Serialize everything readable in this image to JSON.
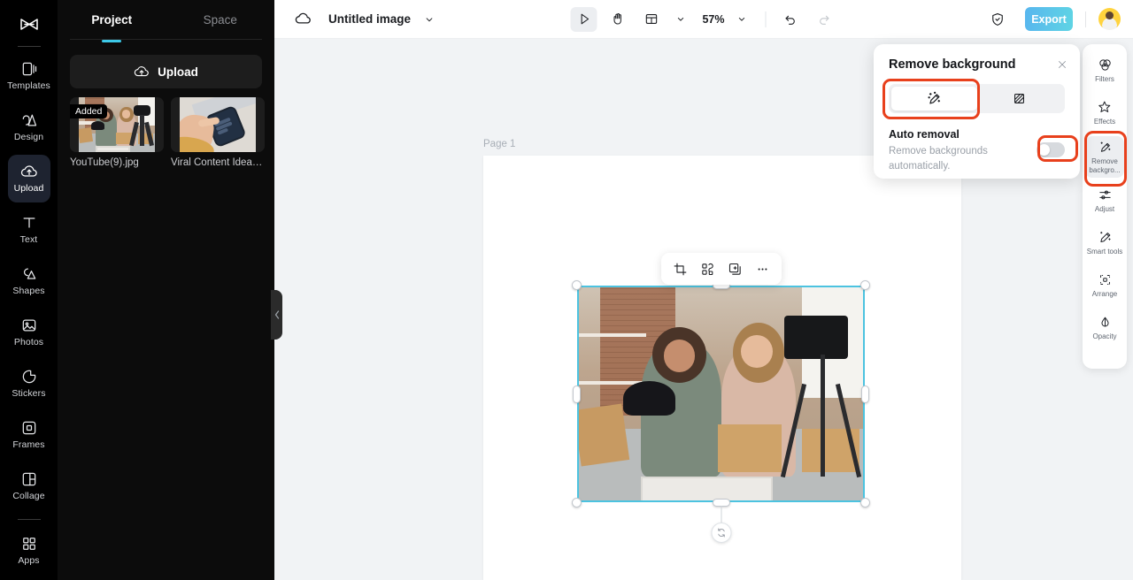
{
  "app": {
    "name": "CapCut",
    "logo_icon": "capcut-logo-icon"
  },
  "rail": {
    "items": [
      {
        "label": "Templates",
        "icon": "templates-icon",
        "active": false
      },
      {
        "label": "Design",
        "icon": "design-icon",
        "active": false
      },
      {
        "label": "Upload",
        "icon": "upload-cloud-icon",
        "active": true
      },
      {
        "label": "Text",
        "icon": "text-icon",
        "active": false
      },
      {
        "label": "Shapes",
        "icon": "shapes-icon",
        "active": false
      },
      {
        "label": "Photos",
        "icon": "photos-icon",
        "active": false
      },
      {
        "label": "Stickers",
        "icon": "stickers-icon",
        "active": false
      },
      {
        "label": "Frames",
        "icon": "frames-icon",
        "active": false
      },
      {
        "label": "Collage",
        "icon": "collage-icon",
        "active": false
      },
      {
        "label": "Apps",
        "icon": "apps-grid-icon",
        "active": false
      }
    ]
  },
  "panel": {
    "tabs": [
      {
        "label": "Project",
        "active": true
      },
      {
        "label": "Space",
        "active": false
      }
    ],
    "upload_button": {
      "label": "Upload",
      "icon": "upload-cloud-icon"
    },
    "assets": [
      {
        "name": "YouTube(9).jpg",
        "badge": "Added"
      },
      {
        "name": "Viral Content Ideas(3...",
        "badge": ""
      }
    ],
    "collapse_icon": "chevron-left-icon"
  },
  "topbar": {
    "cloud_icon": "cloud-sync-icon",
    "doc_title": "Untitled image",
    "title_caret_icon": "chevron-down-icon",
    "tools": [
      {
        "name": "select",
        "icon": "cursor-arrow-icon",
        "selected": true
      },
      {
        "name": "hand",
        "icon": "hand-icon",
        "selected": false
      },
      {
        "name": "layout",
        "icon": "layout-panel-icon",
        "selected": false
      }
    ],
    "layout_caret_icon": "chevron-down-icon",
    "zoom": "57%",
    "zoom_caret_icon": "chevron-down-icon",
    "undo_icon": "undo-icon",
    "redo_icon": "redo-icon",
    "shield_icon": "shield-check-icon",
    "export_label": "Export",
    "avatar": "user-avatar",
    "export_color": "#5bc2e7"
  },
  "canvas": {
    "page_label": "Page 1",
    "background_color": "#f1f3f5",
    "selection_color": "#4cc3e0",
    "rotate_icon": "rotate-icon",
    "floating_toolbar": [
      {
        "name": "crop",
        "icon": "crop-icon"
      },
      {
        "name": "cutout",
        "icon": "cutout-icon"
      },
      {
        "name": "duplicate",
        "icon": "duplicate-plus-icon"
      },
      {
        "name": "more",
        "icon": "more-horizontal-icon"
      }
    ]
  },
  "remove_bg_panel": {
    "title": "Remove background",
    "close_icon": "close-icon",
    "segments": [
      {
        "name": "auto-brush",
        "icon": "magic-brush-icon",
        "active": true
      },
      {
        "name": "stencil",
        "icon": "checker-square-icon",
        "active": false
      }
    ],
    "auto_removal": {
      "label": "Auto removal",
      "description": "Remove backgrounds automatically.",
      "enabled": false
    },
    "highlight_color": "#e8401c"
  },
  "right_toolbar": {
    "items": [
      {
        "label": "Filters",
        "icon": "filters-icon",
        "active": false
      },
      {
        "label": "Effects",
        "icon": "effects-icon",
        "active": false
      },
      {
        "label": "Remove backgro...",
        "icon": "magic-brush-icon",
        "active": true
      },
      {
        "label": "Adjust",
        "icon": "adjust-sliders-icon",
        "active": false
      },
      {
        "label": "Smart tools",
        "icon": "smart-tools-icon",
        "active": false
      },
      {
        "label": "Arrange",
        "icon": "arrange-icon",
        "active": false
      },
      {
        "label": "Opacity",
        "icon": "opacity-drop-icon",
        "active": false
      }
    ]
  }
}
